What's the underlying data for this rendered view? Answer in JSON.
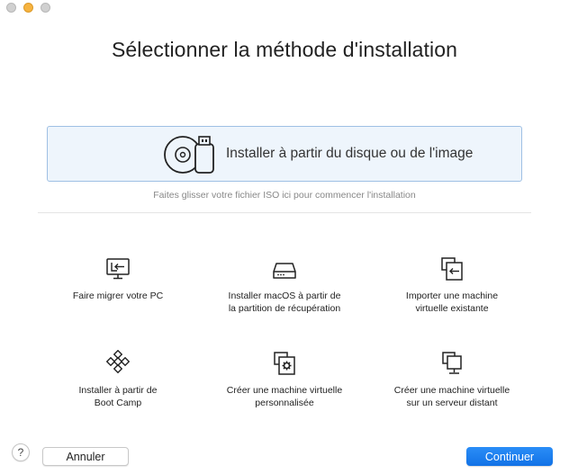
{
  "window": {
    "title": "Sélectionner la méthode d'installation"
  },
  "dropzone": {
    "label": "Installer à partir du disque ou de l'image",
    "icon": "disc-and-usb-icon",
    "hint": "Faites glisser votre fichier ISO ici pour commencer l'installation"
  },
  "options": [
    {
      "label": "Faire migrer votre PC",
      "icon": "monitor-import-icon"
    },
    {
      "label": "Installer macOS à partir de\nla partition de récupération",
      "icon": "hard-drive-icon"
    },
    {
      "label": "Importer une machine\nvirtuelle existante",
      "icon": "import-vm-icon"
    },
    {
      "label": "Installer à partir de\nBoot Camp",
      "icon": "boot-camp-icon"
    },
    {
      "label": "Créer une machine virtuelle\npersonnalisée",
      "icon": "custom-vm-icon"
    },
    {
      "label": "Créer une machine virtuelle\nsur un serveur distant",
      "icon": "remote-server-icon"
    }
  ],
  "footer": {
    "help_label": "?",
    "cancel_label": "Annuler",
    "continue_label": "Continuer"
  },
  "colors": {
    "accent": "#1a7ff0",
    "dropzone_bg": "#eef5fc",
    "dropzone_border": "#9fc0e4"
  }
}
